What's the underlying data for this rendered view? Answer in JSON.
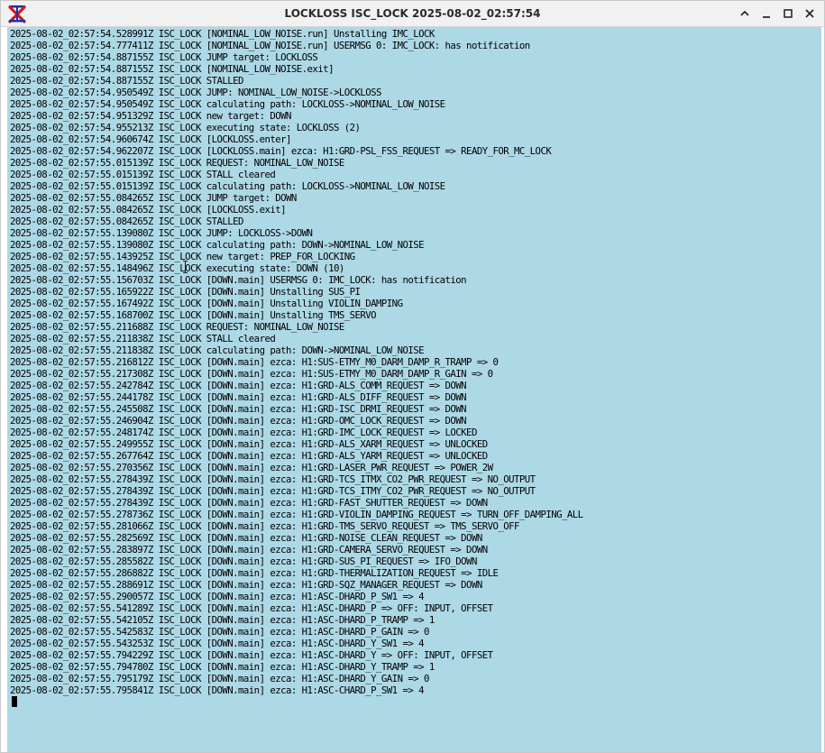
{
  "window": {
    "title": "LOCKLOSS ISC_LOCK 2025-08-02_02:57:54",
    "app_icon": "x-logo-icon",
    "controls": [
      "chevron-up-icon",
      "minimize-icon",
      "maximize-icon",
      "close-icon"
    ]
  },
  "terminal": {
    "background": "#add8e6",
    "lines": [
      "2025-08-02_02:57:54.528991Z ISC_LOCK [NOMINAL_LOW_NOISE.run] Unstalling IMC_LOCK",
      "2025-08-02_02:57:54.777411Z ISC_LOCK [NOMINAL_LOW_NOISE.run] USERMSG 0: IMC_LOCK: has notification",
      "2025-08-02_02:57:54.887155Z ISC_LOCK JUMP target: LOCKLOSS",
      "2025-08-02_02:57:54.887155Z ISC_LOCK [NOMINAL_LOW_NOISE.exit]",
      "2025-08-02_02:57:54.887155Z ISC_LOCK STALLED",
      "2025-08-02_02:57:54.950549Z ISC_LOCK JUMP: NOMINAL_LOW_NOISE->LOCKLOSS",
      "2025-08-02_02:57:54.950549Z ISC_LOCK calculating path: LOCKLOSS->NOMINAL_LOW_NOISE",
      "2025-08-02_02:57:54.951329Z ISC_LOCK new target: DOWN",
      "2025-08-02_02:57:54.955213Z ISC_LOCK executing state: LOCKLOSS (2)",
      "2025-08-02_02:57:54.960674Z ISC_LOCK [LOCKLOSS.enter]",
      "2025-08-02_02:57:54.962207Z ISC_LOCK [LOCKLOSS.main] ezca: H1:GRD-PSL_FSS_REQUEST => READY_FOR_MC_LOCK",
      "2025-08-02_02:57:55.015139Z ISC_LOCK REQUEST: NOMINAL_LOW_NOISE",
      "2025-08-02_02:57:55.015139Z ISC_LOCK STALL cleared",
      "2025-08-02_02:57:55.015139Z ISC_LOCK calculating path: LOCKLOSS->NOMINAL_LOW_NOISE",
      "2025-08-02_02:57:55.084265Z ISC_LOCK JUMP target: DOWN",
      "2025-08-02_02:57:55.084265Z ISC_LOCK [LOCKLOSS.exit]",
      "2025-08-02_02:57:55.084265Z ISC_LOCK STALLED",
      "2025-08-02_02:57:55.139080Z ISC_LOCK JUMP: LOCKLOSS->DOWN",
      "2025-08-02_02:57:55.139080Z ISC_LOCK calculating path: DOWN->NOMINAL_LOW_NOISE",
      "2025-08-02_02:57:55.143925Z ISC_LOCK new target: PREP_FOR_LOCKING",
      "2025-08-02_02:57:55.148496Z ISC_LOCK executing state: DOWN (10)",
      "2025-08-02_02:57:55.156703Z ISC_LOCK [DOWN.main] USERMSG 0: IMC_LOCK: has notification",
      "2025-08-02_02:57:55.165922Z ISC_LOCK [DOWN.main] Unstalling SUS_PI",
      "2025-08-02_02:57:55.167492Z ISC_LOCK [DOWN.main] Unstalling VIOLIN_DAMPING",
      "2025-08-02_02:57:55.168700Z ISC_LOCK [DOWN.main] Unstalling TMS_SERVO",
      "2025-08-02_02:57:55.211688Z ISC_LOCK REQUEST: NOMINAL_LOW_NOISE",
      "2025-08-02_02:57:55.211838Z ISC_LOCK STALL cleared",
      "2025-08-02_02:57:55.211838Z ISC_LOCK calculating path: DOWN->NOMINAL_LOW_NOISE",
      "2025-08-02_02:57:55.216812Z ISC_LOCK [DOWN.main] ezca: H1:SUS-ETMY_M0_DARM_DAMP_R_TRAMP => 0",
      "2025-08-02_02:57:55.217308Z ISC_LOCK [DOWN.main] ezca: H1:SUS-ETMY_M0_DARM_DAMP_R_GAIN => 0",
      "2025-08-02_02:57:55.242784Z ISC_LOCK [DOWN.main] ezca: H1:GRD-ALS_COMM_REQUEST => DOWN",
      "2025-08-02_02:57:55.244178Z ISC_LOCK [DOWN.main] ezca: H1:GRD-ALS_DIFF_REQUEST => DOWN",
      "2025-08-02_02:57:55.245508Z ISC_LOCK [DOWN.main] ezca: H1:GRD-ISC_DRMI_REQUEST => DOWN",
      "2025-08-02_02:57:55.246904Z ISC_LOCK [DOWN.main] ezca: H1:GRD-OMC_LOCK_REQUEST => DOWN",
      "2025-08-02_02:57:55.248174Z ISC_LOCK [DOWN.main] ezca: H1:GRD-IMC_LOCK_REQUEST => LOCKED",
      "2025-08-02_02:57:55.249955Z ISC_LOCK [DOWN.main] ezca: H1:GRD-ALS_XARM_REQUEST => UNLOCKED",
      "2025-08-02_02:57:55.267764Z ISC_LOCK [DOWN.main] ezca: H1:GRD-ALS_YARM_REQUEST => UNLOCKED",
      "2025-08-02_02:57:55.270356Z ISC_LOCK [DOWN.main] ezca: H1:GRD-LASER_PWR_REQUEST => POWER_2W",
      "2025-08-02_02:57:55.278439Z ISC_LOCK [DOWN.main] ezca: H1:GRD-TCS_ITMX_CO2_PWR_REQUEST => NO_OUTPUT",
      "2025-08-02_02:57:55.278439Z ISC_LOCK [DOWN.main] ezca: H1:GRD-TCS_ITMY_CO2_PWR_REQUEST => NO_OUTPUT",
      "2025-08-02_02:57:55.278439Z ISC_LOCK [DOWN.main] ezca: H1:GRD-FAST_SHUTTER_REQUEST => DOWN",
      "2025-08-02_02:57:55.278736Z ISC_LOCK [DOWN.main] ezca: H1:GRD-VIOLIN_DAMPING_REQUEST => TURN_OFF_DAMPING_ALL",
      "2025-08-02_02:57:55.281066Z ISC_LOCK [DOWN.main] ezca: H1:GRD-TMS_SERVO_REQUEST => TMS_SERVO_OFF",
      "2025-08-02_02:57:55.282569Z ISC_LOCK [DOWN.main] ezca: H1:GRD-NOISE_CLEAN_REQUEST => DOWN",
      "2025-08-02_02:57:55.283897Z ISC_LOCK [DOWN.main] ezca: H1:GRD-CAMERA_SERVO_REQUEST => DOWN",
      "2025-08-02_02:57:55.285582Z ISC_LOCK [DOWN.main] ezca: H1:GRD-SUS_PI_REQUEST => IFO_DOWN",
      "2025-08-02_02:57:55.286882Z ISC_LOCK [DOWN.main] ezca: H1:GRD-THERMALIZATION_REQUEST => IDLE",
      "2025-08-02_02:57:55.288691Z ISC_LOCK [DOWN.main] ezca: H1:GRD-SQZ_MANAGER_REQUEST => DOWN",
      "2025-08-02_02:57:55.290057Z ISC_LOCK [DOWN.main] ezca: H1:ASC-DHARD_P_SW1 => 4",
      "2025-08-02_02:57:55.541289Z ISC_LOCK [DOWN.main] ezca: H1:ASC-DHARD_P => OFF: INPUT, OFFSET",
      "2025-08-02_02:57:55.542105Z ISC_LOCK [DOWN.main] ezca: H1:ASC-DHARD_P_TRAMP => 1",
      "2025-08-02_02:57:55.542583Z ISC_LOCK [DOWN.main] ezca: H1:ASC-DHARD_P_GAIN => 0",
      "2025-08-02_02:57:55.543253Z ISC_LOCK [DOWN.main] ezca: H1:ASC-DHARD_Y_SW1 => 4",
      "2025-08-02_02:57:55.794229Z ISC_LOCK [DOWN.main] ezca: H1:ASC-DHARD_Y => OFF: INPUT, OFFSET",
      "2025-08-02_02:57:55.794780Z ISC_LOCK [DOWN.main] ezca: H1:ASC-DHARD_Y_TRAMP => 1",
      "2025-08-02_02:57:55.795179Z ISC_LOCK [DOWN.main] ezca: H1:ASC-DHARD_Y_GAIN => 0",
      "2025-08-02_02:57:55.795841Z ISC_LOCK [DOWN.main] ezca: H1:ASC-CHARD_P_SW1 => 4"
    ]
  }
}
